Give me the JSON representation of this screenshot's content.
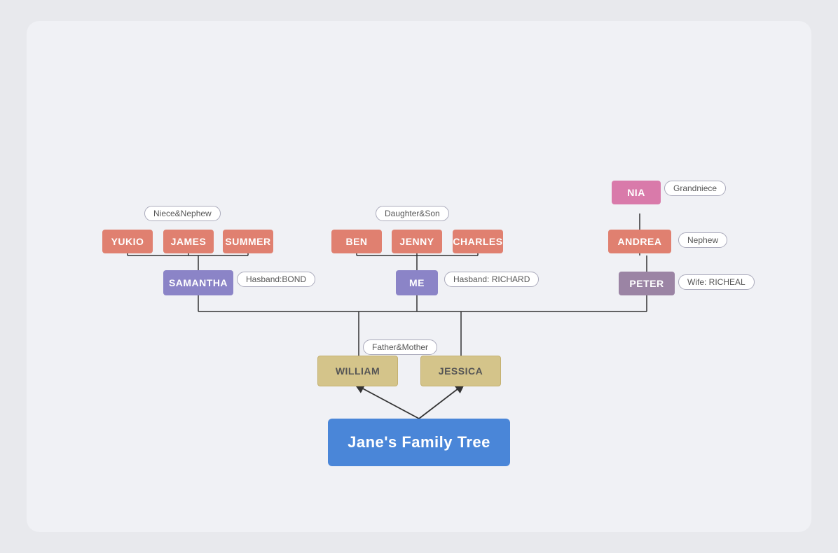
{
  "title": "Jane's Family Tree",
  "nodes": {
    "jane": "Jane's Family Tree",
    "william": "WILLIAM",
    "jessica": "JESSICA",
    "samantha": "SAMANTHA",
    "me": "ME",
    "yukio": "YUKIO",
    "james": "JAMES",
    "summer": "SUMMER",
    "ben": "BEN",
    "jenny": "JENNY",
    "charles": "CHARLES",
    "andrea": "ANDREA",
    "nia": "NIA",
    "peter": "PETER"
  },
  "labels": {
    "niece_nephew": "Niece&Nephew",
    "daughter_son": "Daughter&Son",
    "grandniece": "Grandniece",
    "nephew": "Nephew",
    "father_mother": "Father&Mother",
    "husband_bond": "Hasband:BOND",
    "husband_richard": "Hasband: RICHARD",
    "wife_richeal": "Wife: RICHEAL"
  }
}
